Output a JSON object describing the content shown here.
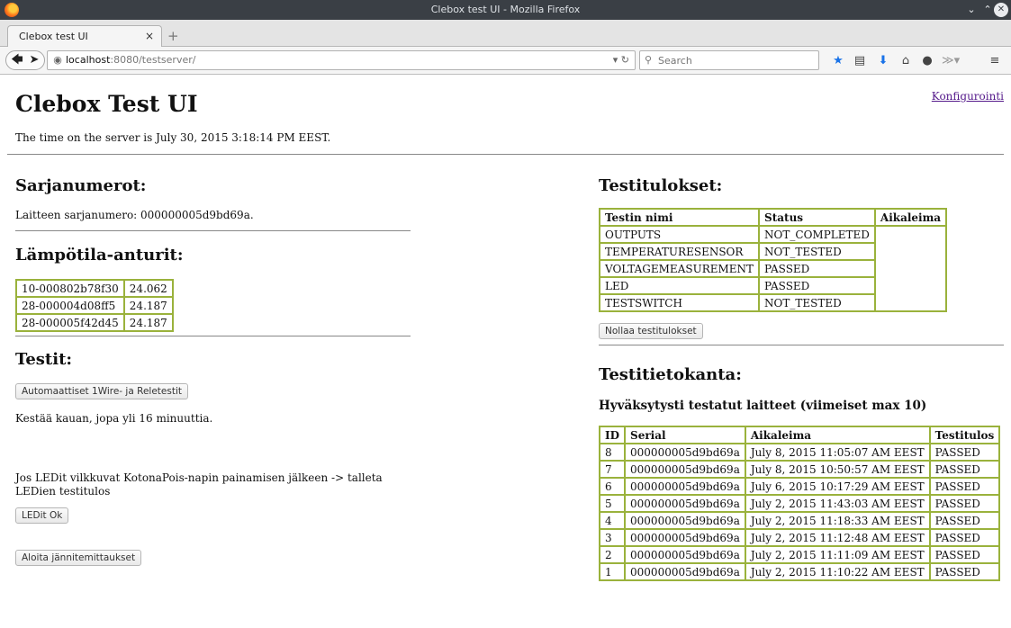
{
  "window": {
    "title": "Clebox test UI - Mozilla Firefox"
  },
  "browser": {
    "tab_title": "Clebox test UI",
    "tab_close": "×",
    "new_tab": "+",
    "url_host": "localhost",
    "url_rest": ":8080/testserver/",
    "search_placeholder": "Search"
  },
  "page": {
    "title": "Clebox Test UI",
    "config_link": "Konfigurointi",
    "server_time": "The time on the server is July 30, 2015 3:18:14 PM EEST."
  },
  "serials": {
    "heading": "Sarjanumerot:",
    "device_serial": "Laitteen sarjanumero: 000000005d9bd69a."
  },
  "temperature": {
    "heading": "Lämpötila-anturit:",
    "sensors": [
      {
        "id": "10-000802b78f30",
        "value": "24.062"
      },
      {
        "id": "28-000004d08ff5",
        "value": "24.187"
      },
      {
        "id": "28-000005f42d45",
        "value": "24.187"
      }
    ]
  },
  "tests": {
    "heading": "Testit:",
    "auto_button": "Automaattiset 1Wire- ja Reletestit",
    "duration_note": "Kestää kauan, jopa yli 16 minuuttia.",
    "led_note_line1": "Jos LEDit vilkkuvat KotonaPois-napin painamisen jälkeen -> talleta",
    "led_note_line2": "LEDien testitulos",
    "led_ok_button": "LEDit Ok",
    "voltage_button": "Aloita jännitemittaukset"
  },
  "results": {
    "heading": "Testitulokset:",
    "columns": [
      "Testin nimi",
      "Status",
      "Aikaleima"
    ],
    "rows": [
      {
        "name": "OUTPUTS",
        "status": "NOT_COMPLETED"
      },
      {
        "name": "TEMPERATURESENSOR",
        "status": "NOT_TESTED"
      },
      {
        "name": "VOLTAGEMEASUREMENT",
        "status": "PASSED"
      },
      {
        "name": "LED",
        "status": "PASSED"
      },
      {
        "name": "TESTSWITCH",
        "status": "NOT_TESTED"
      }
    ],
    "reset_button": "Nollaa testitulokset"
  },
  "database": {
    "heading": "Testitietokanta:",
    "subheading": "Hyväksytysti testatut laitteet (viimeiset max 10)",
    "columns": [
      "ID",
      "Serial",
      "Aikaleima",
      "Testitulos"
    ],
    "rows": [
      {
        "id": "8",
        "serial": "000000005d9bd69a",
        "time": "July 8, 2015 11:05:07 AM EEST",
        "result": "PASSED"
      },
      {
        "id": "7",
        "serial": "000000005d9bd69a",
        "time": "July 8, 2015 10:50:57 AM EEST",
        "result": "PASSED"
      },
      {
        "id": "6",
        "serial": "000000005d9bd69a",
        "time": "July 6, 2015 10:17:29 AM EEST",
        "result": "PASSED"
      },
      {
        "id": "5",
        "serial": "000000005d9bd69a",
        "time": "July 2, 2015 11:43:03 AM EEST",
        "result": "PASSED"
      },
      {
        "id": "4",
        "serial": "000000005d9bd69a",
        "time": "July 2, 2015 11:18:33 AM EEST",
        "result": "PASSED"
      },
      {
        "id": "3",
        "serial": "000000005d9bd69a",
        "time": "July 2, 2015 11:12:48 AM EEST",
        "result": "PASSED"
      },
      {
        "id": "2",
        "serial": "000000005d9bd69a",
        "time": "July 2, 2015 11:11:09 AM EEST",
        "result": "PASSED"
      },
      {
        "id": "1",
        "serial": "000000005d9bd69a",
        "time": "July 2, 2015 11:10:22 AM EEST",
        "result": "PASSED"
      }
    ]
  },
  "icons": {
    "firefox_logo": "firefox-logo-icon",
    "back": "back-arrow-icon",
    "forward": "forward-arrow-icon",
    "site_info": "globe-icon",
    "reload": "reload-icon",
    "search": "search-icon",
    "bookmark": "star-icon",
    "reading_list": "clipboard-icon",
    "downloads": "download-arrow-icon",
    "home": "home-icon",
    "chat": "chat-bubble-icon",
    "menu": "hamburger-menu-icon"
  },
  "colors": {
    "table_border": "#9ab23c",
    "link": "#551a8b",
    "bookmark_star": "#1a73e8",
    "download_arrow": "#1a73e8"
  }
}
